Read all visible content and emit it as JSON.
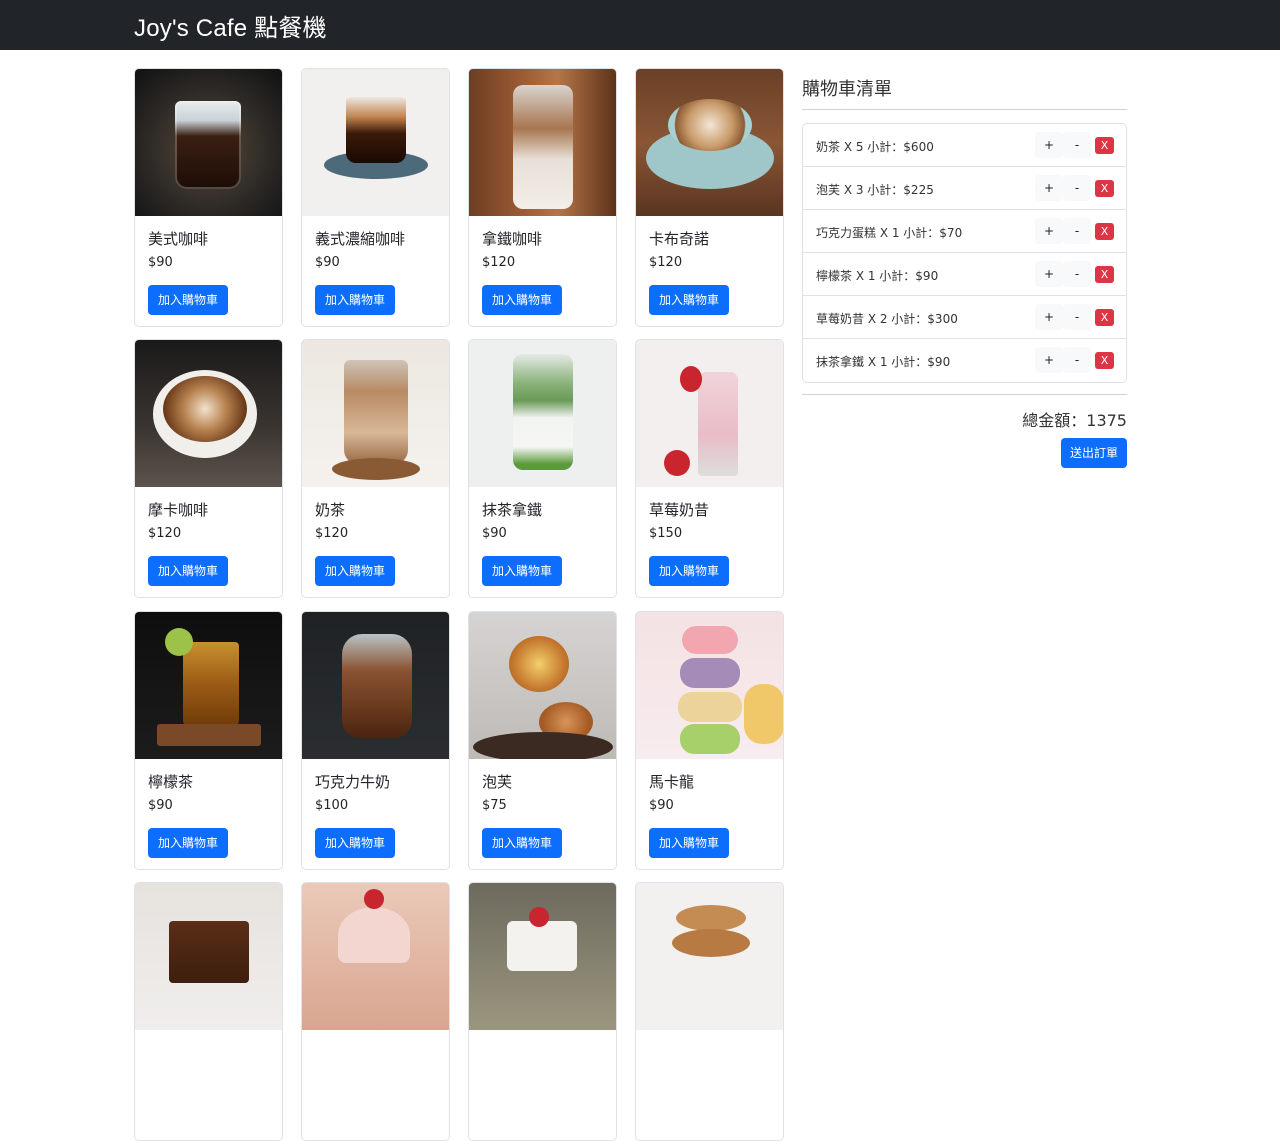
{
  "app": {
    "title": "Joy's Cafe 點餐機"
  },
  "colors": {
    "navbar": "#212529",
    "primary": "#0d6efd",
    "danger": "#dc3545"
  },
  "products": [
    {
      "name": "美式咖啡",
      "price": "$90",
      "button": "加入購物車",
      "icon": "americano-photo"
    },
    {
      "name": "義式濃縮咖啡",
      "price": "$90",
      "button": "加入購物車",
      "icon": "espresso-photo"
    },
    {
      "name": "拿鐵咖啡",
      "price": "$120",
      "button": "加入購物車",
      "icon": "latte-photo"
    },
    {
      "name": "卡布奇諾",
      "price": "$120",
      "button": "加入購物車",
      "icon": "cappuccino-photo"
    },
    {
      "name": "摩卡咖啡",
      "price": "$120",
      "button": "加入購物車",
      "icon": "mocha-photo"
    },
    {
      "name": "奶茶",
      "price": "$120",
      "button": "加入購物車",
      "icon": "milk-tea-photo"
    },
    {
      "name": "抹茶拿鐵",
      "price": "$90",
      "button": "加入購物車",
      "icon": "matcha-latte-photo"
    },
    {
      "name": "草莓奶昔",
      "price": "$150",
      "button": "加入購物車",
      "icon": "strawberry-shake-photo"
    },
    {
      "name": "檸檬茶",
      "price": "$90",
      "button": "加入購物車",
      "icon": "lemon-tea-photo"
    },
    {
      "name": "巧克力牛奶",
      "price": "$100",
      "button": "加入購物車",
      "icon": "chocolate-milk-photo"
    },
    {
      "name": "泡芙",
      "price": "$75",
      "button": "加入購物車",
      "icon": "cream-puff-photo"
    },
    {
      "name": "馬卡龍",
      "price": "$90",
      "button": "加入購物車",
      "icon": "macaron-photo"
    },
    {
      "icon": "chocolate-cake-photo"
    },
    {
      "icon": "cupcake-photo"
    },
    {
      "icon": "fruit-cake-photo"
    },
    {
      "icon": "cookies-photo"
    }
  ],
  "cart": {
    "title": "購物車清單",
    "items": [
      {
        "text": "奶茶 X 5 小計：$600",
        "plus": "+",
        "minus": "-",
        "remove": "X"
      },
      {
        "text": "泡芙 X 3 小計：$225",
        "plus": "+",
        "minus": "-",
        "remove": "X"
      },
      {
        "text": "巧克力蛋糕 X 1 小計：$70",
        "plus": "+",
        "minus": "-",
        "remove": "X"
      },
      {
        "text": "檸檬茶 X 1 小計：$90",
        "plus": "+",
        "minus": "-",
        "remove": "X"
      },
      {
        "text": "草莓奶昔 X 2 小計：$300",
        "plus": "+",
        "minus": "-",
        "remove": "X"
      },
      {
        "text": "抹茶拿鐵 X 1 小計：$90",
        "plus": "+",
        "minus": "-",
        "remove": "X"
      }
    ],
    "total": "總金額：1375",
    "submit": "送出訂單"
  }
}
